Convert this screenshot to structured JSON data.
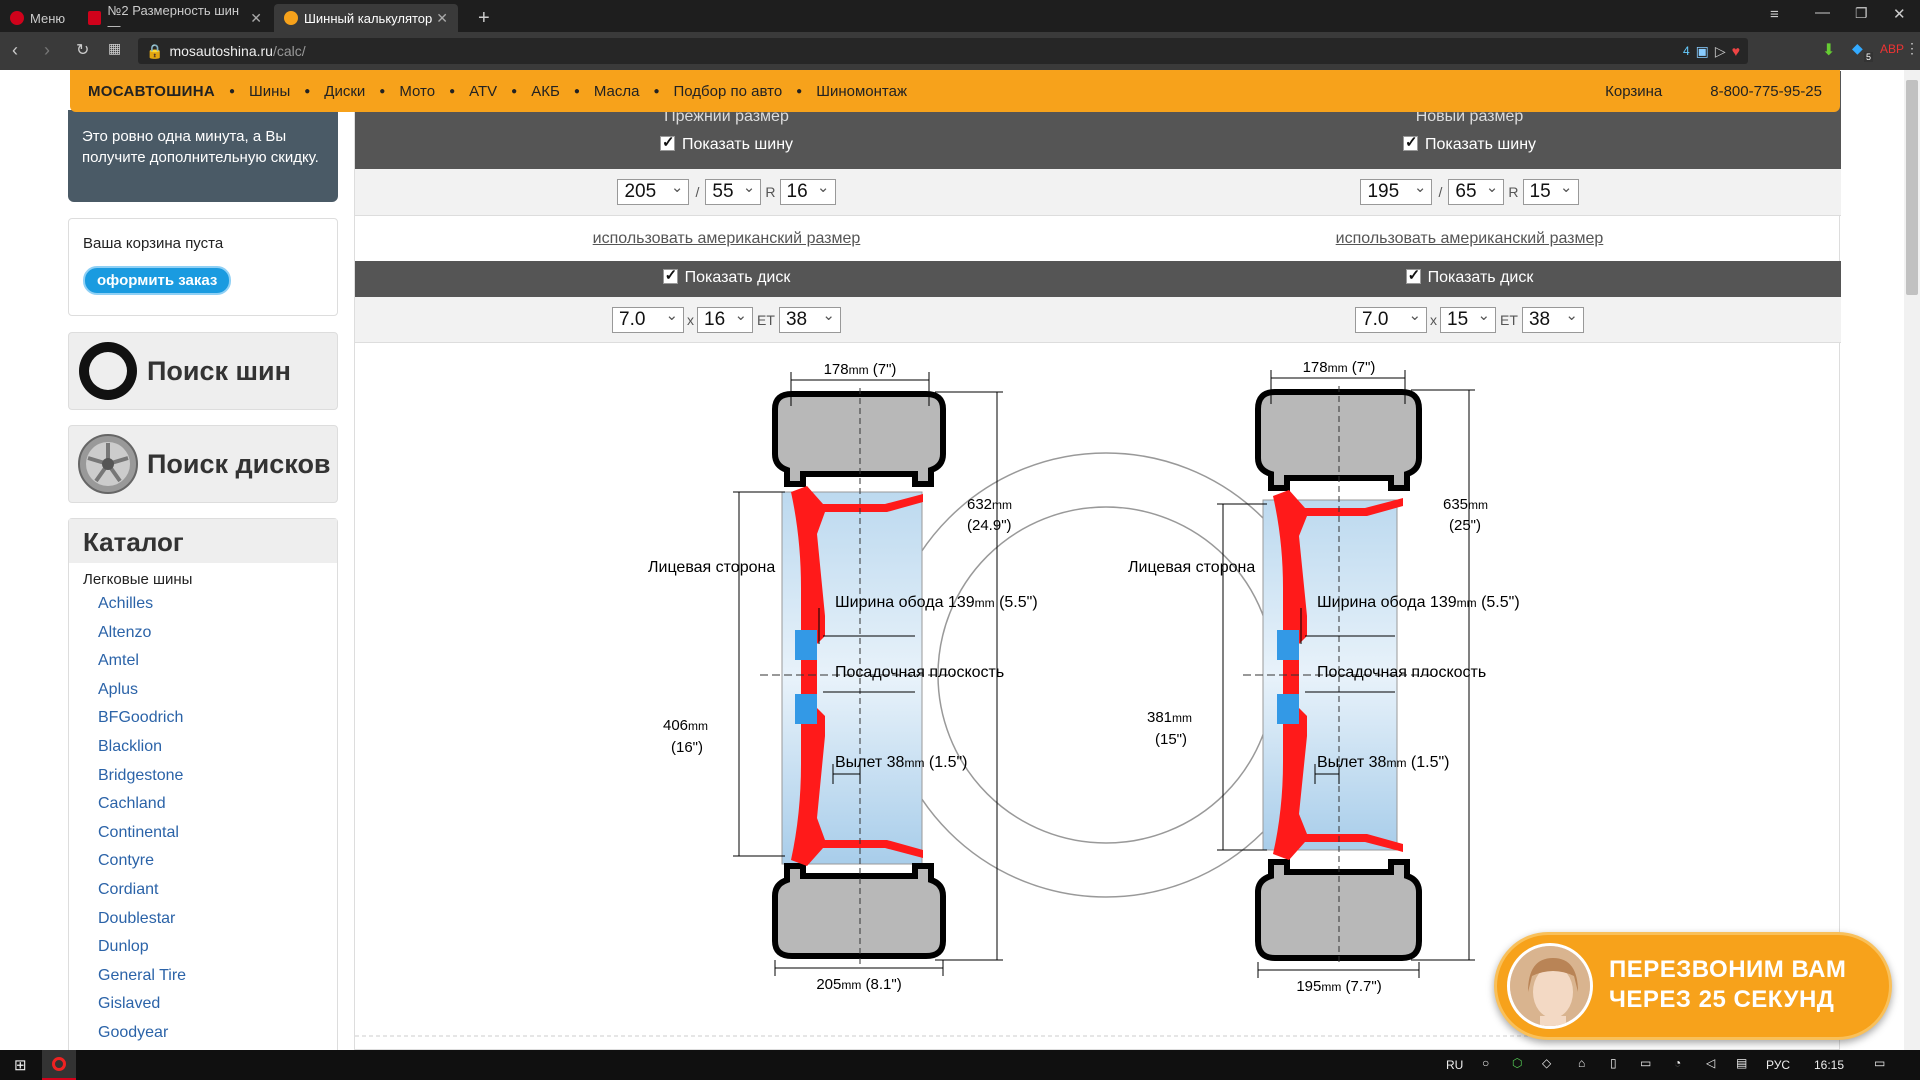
{
  "browser": {
    "menu_label": "Меню",
    "tabs": [
      {
        "label": "№2 Размерность шин —"
      },
      {
        "label": "Шинный калькулятор"
      }
    ],
    "url": "mosautoshina.ru/calc/",
    "url_host": "mosautoshina.ru",
    "url_path": "/calc/",
    "ext_badges": [
      "4",
      "5"
    ]
  },
  "nav": {
    "brand": "МОСАВТОШИНА",
    "items": [
      "Шины",
      "Диски",
      "Мото",
      "ATV",
      "АКБ",
      "Масла",
      "Подбор по авто",
      "Шиномонтаж"
    ],
    "cart": "Корзина",
    "phone": "8-800-775-95-25"
  },
  "sidebar": {
    "promo_text": "Это ровно одна минута, а Вы получите дополнительную скидку.",
    "cart_empty": "Ваша корзина пуста",
    "order_button": "оформить заказ",
    "tire_search": "Поиск шин",
    "disk_search": "Поиск дисков",
    "catalog_title": "Каталог",
    "catalog_sub": "Легковые шины",
    "brands": [
      "Achilles",
      "Altenzo",
      "Amtel",
      "Aplus",
      "BFGoodrich",
      "Blacklion",
      "Bridgestone",
      "Cachland",
      "Continental",
      "Contyre",
      "Cordiant",
      "Doublestar",
      "Dunlop",
      "General Tire",
      "Gislaved",
      "Goodyear"
    ]
  },
  "calc": {
    "old": {
      "title": "Прежний размер",
      "show_tire": "Показать шину",
      "width": "205",
      "profile": "55",
      "r_label": "R",
      "diameter": "16",
      "american": "использовать американский размер",
      "show_disk": "Показать диск",
      "rim_width": "7.0",
      "x_label": "x",
      "rim_diameter": "16",
      "et_label": "ET",
      "et": "38"
    },
    "new": {
      "title": "Новый размер",
      "show_tire": "Показать шину",
      "width": "195",
      "profile": "65",
      "r_label": "R",
      "diameter": "15",
      "american": "использовать американский размер",
      "show_disk": "Показать диск",
      "rim_width": "7.0",
      "x_label": "x",
      "rim_diameter": "15",
      "et_label": "ET",
      "et": "38"
    },
    "slash": "/"
  },
  "diagram": {
    "old": {
      "rim_top": "178",
      "rim_top_in": "(7\")",
      "outer_d": "632",
      "outer_d_in": "(24.9\")",
      "face_label": "Лицевая сторона",
      "rim_width_label": "Ширина обода",
      "rim_width_val": "139",
      "rim_width_in": "(5.5\")",
      "seat_label": "Посадочная плоскость",
      "rim_d": "406",
      "rim_d_in": "(16\")",
      "offset_label": "Вылет",
      "offset_val": "38",
      "offset_in": "(1.5\")",
      "tire_width": "205",
      "tire_width_in": "(8.1\")"
    },
    "new": {
      "rim_top": "178",
      "rim_top_in": "(7\")",
      "outer_d": "635",
      "outer_d_in": "(25\")",
      "face_label": "Лицевая сторона",
      "rim_width_label": "Ширина обода",
      "rim_width_val": "139",
      "rim_width_in": "(5.5\")",
      "seat_label": "Посадочная плоскость",
      "rim_d": "381",
      "rim_d_in": "(15\")",
      "offset_label": "Вылет",
      "offset_val": "38",
      "offset_in": "(1.5\")",
      "tire_width": "195",
      "tire_width_in": "(7.7\")"
    },
    "unit": "mm"
  },
  "callback": {
    "line1": "ПЕРЕЗВОНИМ ВАМ",
    "line2": "ЧЕРЕЗ 25 СЕКУНД"
  },
  "taskbar": {
    "lang_ru": "RU",
    "lang": "РУС",
    "time": "16:15"
  },
  "colors": {
    "orange": "#f7a21b",
    "dark": "#555555",
    "link": "#2b63a8",
    "rim_red": "#ff0000",
    "rim_blue": "#8fc3e6"
  }
}
